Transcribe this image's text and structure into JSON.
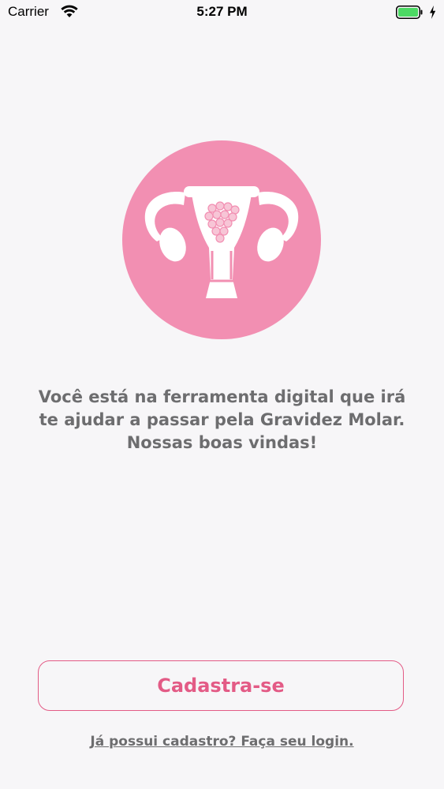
{
  "status_bar": {
    "carrier": "Carrier",
    "time": "5:27 PM",
    "battery_color": "#4cd964"
  },
  "logo": {
    "icon": "uterus-icon",
    "circle_color": "#f28fb2"
  },
  "welcome": {
    "line1": "Você está na ferramenta digital que irá",
    "line2": "te ajudar a passar pela Gravidez Molar.",
    "line3": "Nossas boas vindas!"
  },
  "actions": {
    "register_label": "Cadastra-se",
    "login_link": "Já possui cadastro? Faça seu login."
  },
  "colors": {
    "accent": "#e35b86",
    "text_gray": "#6d6d6f",
    "background": "#f7f6f8"
  }
}
